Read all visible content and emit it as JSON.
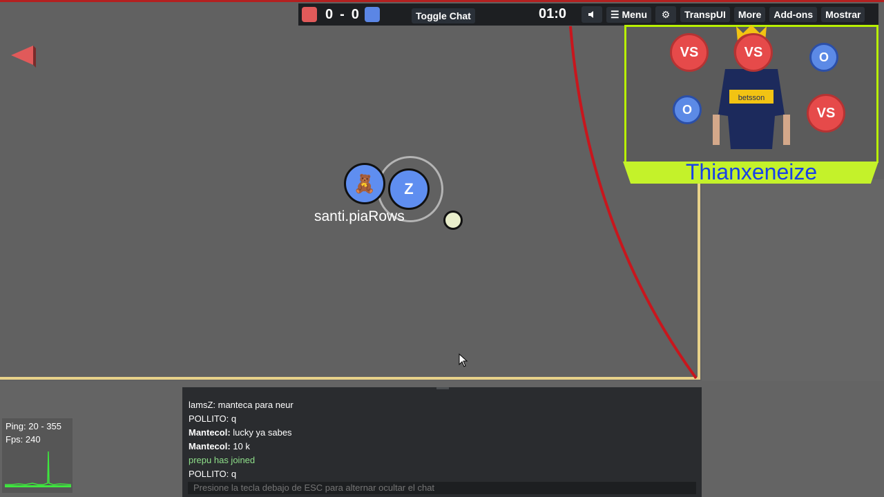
{
  "scoreboard": {
    "red_score": "0",
    "separator": "-",
    "blue_score": "0",
    "red_color": "#e15a5a",
    "blue_color": "#5b86e5"
  },
  "topbar": {
    "toggle_chat": "Toggle Chat",
    "timer": "01:0",
    "volume_icon": "speaker-icon",
    "menu_label": "☰ Menu",
    "settings_icon": "gear-icon",
    "transp_ui": "TranspUI",
    "more": "More",
    "addons": "Add-ons",
    "mostrar": "Mostrar"
  },
  "overlay": {
    "streamer_name": "Thianxeneize",
    "badges": [
      "VS",
      "VS",
      "O",
      "O",
      "VS"
    ],
    "jersey_text": "betsson"
  },
  "players": {
    "bear_avatar": "🧸",
    "z_avatar": "Z",
    "name": "santi.piaRows"
  },
  "stats": {
    "ping": "Ping: 20 - 355",
    "fps": "Fps: 240"
  },
  "chat": {
    "messages": [
      {
        "author": "",
        "text": "lamsZ: manteca para neur",
        "type": "normal"
      },
      {
        "author": "",
        "text": "POLLITO: q",
        "type": "normal"
      },
      {
        "author": "Mantecol:",
        "text": " lucky ya sabes",
        "type": "bold"
      },
      {
        "author": "Mantecol:",
        "text": " 10 k",
        "type": "bold"
      },
      {
        "author": "",
        "text": "prepu has joined",
        "type": "join"
      },
      {
        "author": "",
        "text": "POLLITO: q",
        "type": "normal"
      }
    ],
    "placeholder": "Presione la tecla debajo de ESC para alternar ocultar el chat"
  },
  "colors": {
    "field": "#616161",
    "boundary": "#e8d28a",
    "goal_arc": "#c8161d",
    "overlay_accent": "#c4f22a"
  }
}
